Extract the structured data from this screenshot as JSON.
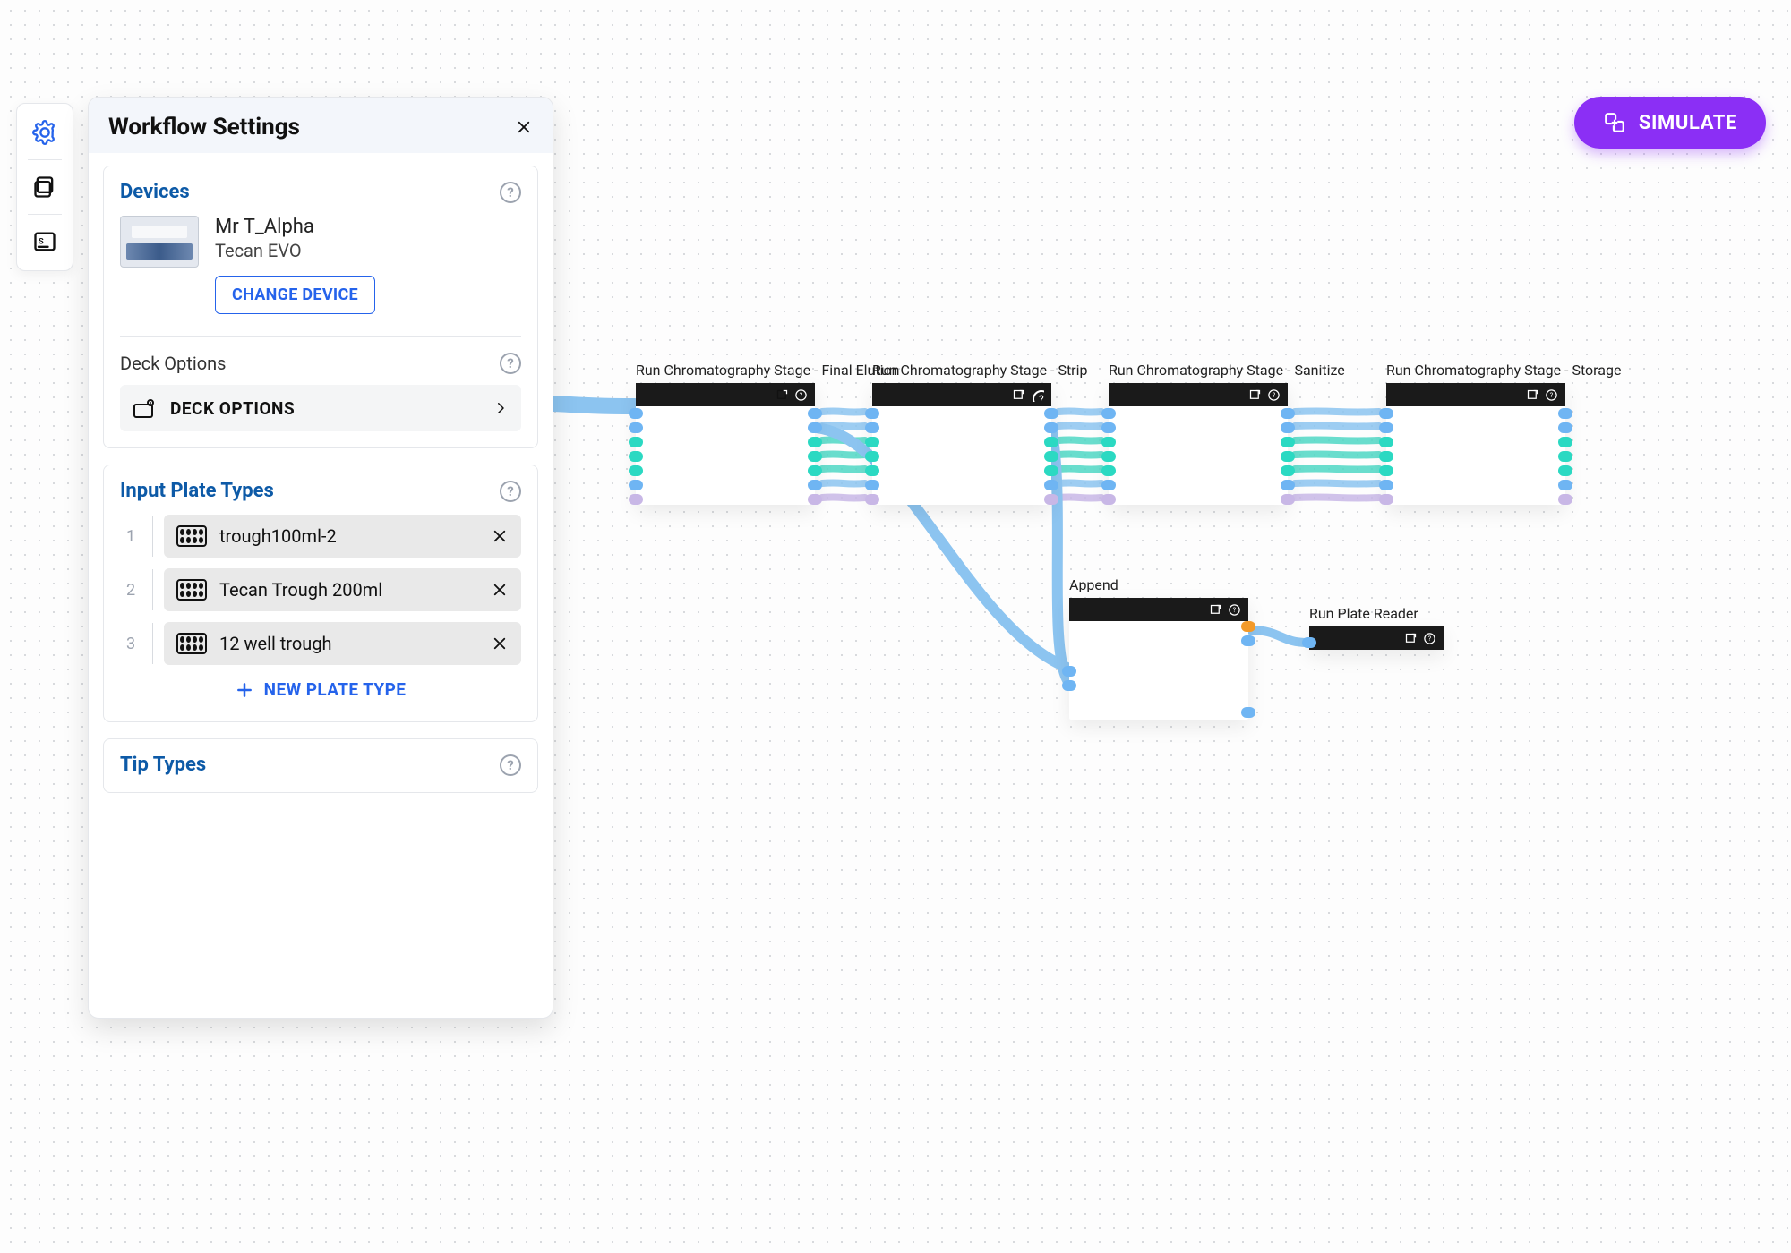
{
  "panel": {
    "title": "Workflow Settings",
    "devices": {
      "title": "Devices",
      "name": "Mr T_Alpha",
      "model": "Tecan EVO",
      "change_button": "CHANGE DEVICE"
    },
    "deck": {
      "label": "Deck Options",
      "button": "DECK OPTIONS"
    },
    "input_plates": {
      "title": "Input Plate Types",
      "items": [
        {
          "index": "1",
          "name": "trough100ml-2"
        },
        {
          "index": "2",
          "name": "Tecan Trough 200ml"
        },
        {
          "index": "3",
          "name": "12 well trough"
        }
      ],
      "new_button": "NEW PLATE TYPE"
    },
    "tip_types": {
      "title": "Tip Types"
    }
  },
  "simulate_label": "SIMULATE",
  "nodes": {
    "n1": "Run Chromatography Stage - Final Elution",
    "n2": "Run Chromatography Stage - Strip",
    "n3": "Run Chromatography Stage - Sanitize",
    "n4": "Run Chromatography Stage - Storage",
    "n5": "Append",
    "n6": "Run Plate Reader"
  },
  "colors": {
    "brand_blue": "#0d5aa7",
    "accent_blue": "#2563eb",
    "purple": "#8b2ff5",
    "wire_blue": "#8cc4f0",
    "wire_teal": "#4fd7c4"
  }
}
